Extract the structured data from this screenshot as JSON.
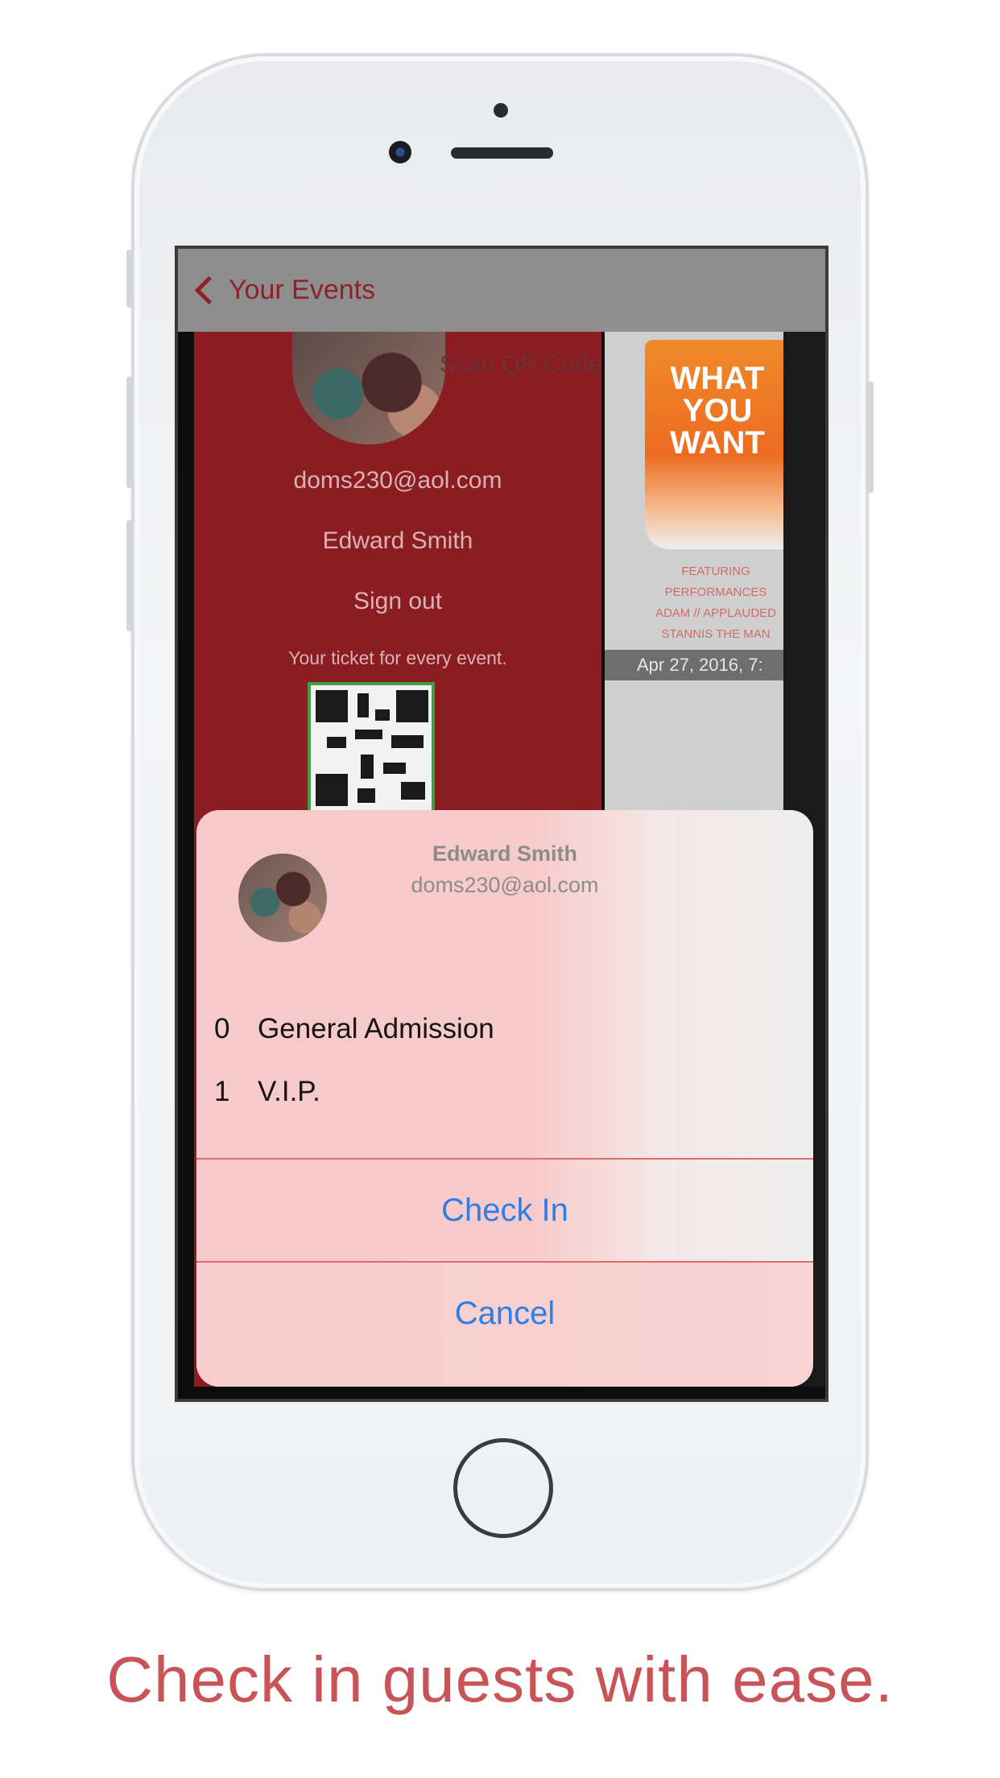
{
  "navbar": {
    "back_label": "Your Events"
  },
  "background_profile": {
    "scan_label": "Scan QR Code",
    "email": "doms230@aol.com",
    "name": "Edward Smith",
    "signout": "Sign out",
    "tagline": "Your ticket for every event."
  },
  "background_event": {
    "poster_title": "WHAT YOU WANT",
    "poster_lines": [
      "FEATURING PERFORMANCES",
      "ADAM // APPLAUDED",
      "STANNIS THE MAN"
    ],
    "date": "Apr 27, 2016, 7:"
  },
  "sheet": {
    "name": "Edward Smith",
    "email": "doms230@aol.com",
    "tickets": [
      {
        "count": "0",
        "label": "General Admission"
      },
      {
        "count": "1",
        "label": "V.I.P."
      }
    ],
    "check_in_label": "Check In",
    "cancel_label": "Cancel"
  },
  "caption": "Check in guests with ease."
}
